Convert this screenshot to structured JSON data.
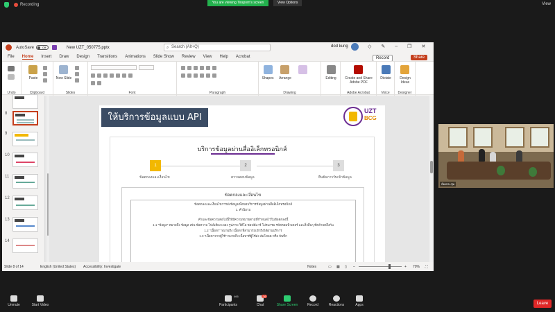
{
  "zoom_top": {
    "recording": "Recording",
    "viewing_banner": "You are viewing Tiraporn's screen",
    "view_options": "View Options",
    "view": "View"
  },
  "ppt": {
    "autosave": "AutoSave",
    "autosave_state": "Off",
    "filename": "New UZT_050775.pptx",
    "search_placeholder": "Search (Alt+Q)",
    "user": "dod kung",
    "menu": [
      "File",
      "Home",
      "Insert",
      "Draw",
      "Design",
      "Transitions",
      "Animations",
      "Slide Show",
      "Review",
      "View",
      "Help",
      "Acrobat"
    ],
    "record_label": "Record",
    "share_label": "Share",
    "groups": {
      "undo": "Undo",
      "clipboard": "Clipboard",
      "slides": "Slides",
      "font": "Font",
      "paragraph": "Paragraph",
      "drawing": "Drawing",
      "acrobat": "Adobe Acrobat",
      "voice": "Voice",
      "designer": "Designer"
    },
    "buttons": {
      "paste": "Paste",
      "new_slide": "New Slide",
      "shapes": "Shapes",
      "arrange": "Arrange",
      "editing": "Editing",
      "create_pdf": "Create and Share Adobe PDF",
      "dictate": "Dictate",
      "design_ideas": "Design Ideas"
    },
    "thumb_numbers": [
      "8",
      "9",
      "10",
      "11",
      "12",
      "13",
      "14"
    ],
    "status": {
      "slide": "Slide 8 of 14",
      "language": "English (United States)",
      "accessibility": "Accessibility: Investigate",
      "notes": "Notes",
      "zoom": "70%"
    }
  },
  "slide": {
    "title": "ให้บริการข้อมูลแบบ API",
    "logo_top": "UZT",
    "logo_bottom": "BCG",
    "card_title": "บริการข้อมูลผ่านสื่ออิเล็กทรอนิกส์",
    "steps": [
      {
        "num": "1",
        "label": "ข้อตกลงและเงื่อนไข"
      },
      {
        "num": "2",
        "label": "ตรวจสอบข้อมูล"
      },
      {
        "num": "3",
        "label": "ยืนยันการรับเข้าข้อมูล"
      }
    ],
    "inner_title": "ข้อตกลงและเงื่อนไข",
    "lines": [
      "ข้อตกลงและเงื่อนไขการส่งข้อมูลเพื่อขอบริการข้อมูลผ่านสื่ออิเล็กทรอนิกส์",
      "1. คำนิยาม",
      "คำและข้อความต่อไปนี้ให้มีความหมายตามที่กำหนดไว้ในข้อตกลงนี้",
      "1.1 \"ข้อมูล\" หมายถึง ข้อมูล เช่น ข้อความ ไฟล์เสียง เพลง รูปภาพ วิดีโอ ซอฟต์แวร์ โปรแกรม รหัสคอมพิวเตอร์ และสิ่งอื่นๆ ที่คล้ายคลึงกัน",
      "1.2 \"เนื้อหา\" หมายถึง เนื้อหาที่สามารถเข้าถึงได้ผ่านบริการ",
      "1.3 \"เนื้อหาจากผู้ใช้\" หมายถึง เนื้อหาที่ผู้ใช้ส่ง อัพโหลด หรือ บันทึก"
    ]
  },
  "video": {
    "participant_name": "ห้องประชุม"
  },
  "zoom_bottom": {
    "unmute": "Unmute",
    "start_video": "Start Video",
    "participants": "Participants",
    "participants_count": "466",
    "chat": "Chat",
    "chat_badge": "16",
    "share_screen": "Share Screen",
    "record": "Record",
    "reactions": "Reactions",
    "apps": "Apps",
    "leave": "Leave"
  }
}
